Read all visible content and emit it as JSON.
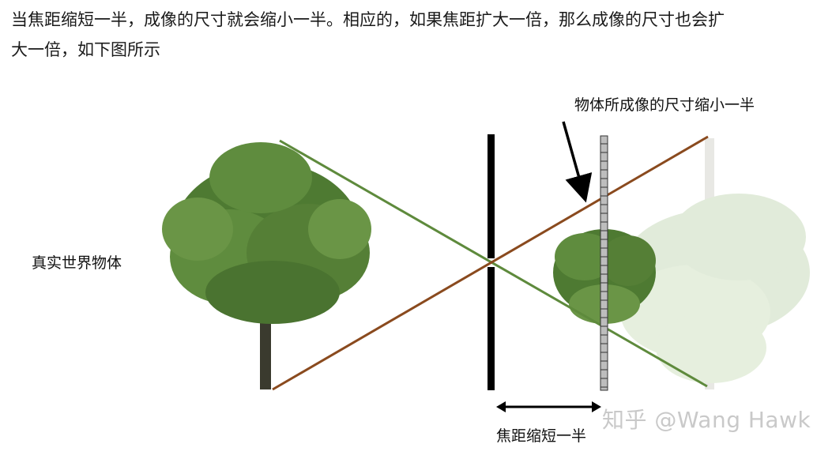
{
  "paragraph": {
    "line1": "当焦距缩短一半，成像的尺寸就会缩小一半。相应的，如果焦距扩大一倍，那么成像的尺寸也会扩",
    "line2": "大一倍，如下图所示"
  },
  "diagram": {
    "real_object_label": "真实世界物体",
    "image_label": "物体所成像的尺寸缩小一半",
    "focal_label": "焦距缩短一半",
    "watermark": "知乎 @Wang Hawk",
    "colors": {
      "ray_green": "#5e8a3c",
      "ray_brown": "#8a4a1e",
      "barrier": "#000000",
      "tree_foliage": "#4e7a32",
      "tree_trunk": "#3a3a2e",
      "sensor_fill": "#bdbdbd"
    }
  }
}
